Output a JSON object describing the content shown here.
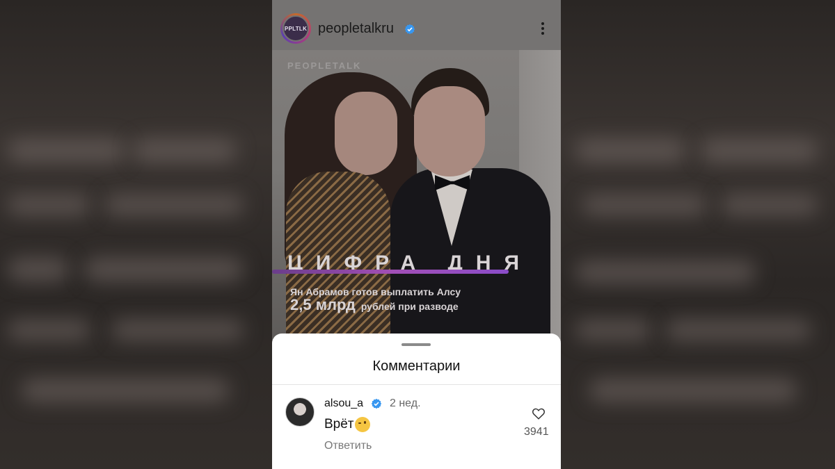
{
  "post": {
    "username": "peopletalkru",
    "avatar_text": "PPLTLK",
    "watermark": "PEOPLETALK",
    "overlay_title": "ЦИФРА ДНЯ",
    "overlay_line1": "Ян Абрамов готов выплатить Алсу",
    "overlay_amount": "2,5 млрд",
    "overlay_line2": "рублей при разводе"
  },
  "comments_sheet": {
    "title": "Комментарии",
    "comment": {
      "username": "alsou_a",
      "time": "2 нед.",
      "text": "Врёт",
      "reply_label": "Ответить",
      "likes": "3941"
    }
  },
  "icons": {
    "verified": "verified-badge-icon",
    "more": "kebab-menu-icon",
    "like": "heart-icon",
    "emoji": "wink-emoji-icon"
  },
  "colors": {
    "verified": "#3897f0",
    "accent_bar": "#a24fb5"
  }
}
